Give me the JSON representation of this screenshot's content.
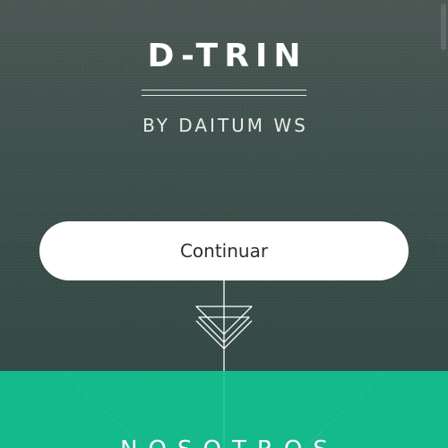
{
  "app": {
    "title": "D-TRIN",
    "subtitle": "BY DAITUM WS"
  },
  "actions": {
    "continue_label": "Continuar"
  },
  "sections": {
    "next_title": "NOSOTROS"
  },
  "colors": {
    "hero_bg": "#3d4f4b",
    "accent_green": "#14b98c",
    "button_bg": "#ffffff",
    "text_light": "#ffffff"
  },
  "icons": {
    "connector": "triangle-arrow-down-icon"
  }
}
